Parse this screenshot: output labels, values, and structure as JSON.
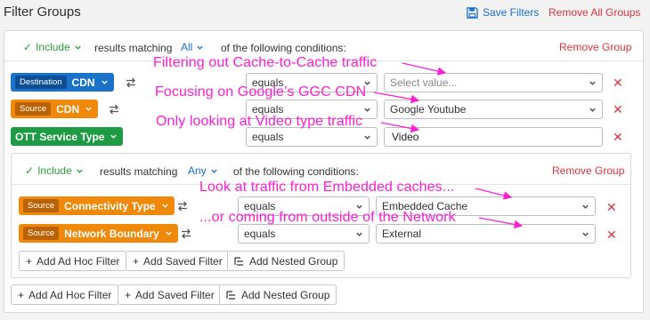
{
  "header": {
    "title": "Filter Groups",
    "save_label": "Save Filters",
    "remove_all_label": "Remove All Groups"
  },
  "outer_group": {
    "include_label": "Include",
    "matching_text": "results matching",
    "mode": "All",
    "conditions_text": "of the following conditions:",
    "remove_label": "Remove Group",
    "rows": [
      {
        "tag": "Destination",
        "dimension": "CDN",
        "operator": "equals",
        "value": "",
        "placeholder": "Select value..."
      },
      {
        "tag": "Source",
        "dimension": "CDN",
        "operator": "equals",
        "value": "Google Youtube"
      },
      {
        "tag": "",
        "dimension": "OTT Service Type",
        "operator": "equals",
        "value": "Video"
      }
    ],
    "buttons": {
      "ad_hoc": "Add Ad Hoc Filter",
      "saved": "Add Saved Filter",
      "nested": "Add Nested Group"
    }
  },
  "nested_group": {
    "include_label": "Include",
    "matching_text": "results matching",
    "mode": "Any",
    "conditions_text": "of the following conditions:",
    "remove_label": "Remove Group",
    "rows": [
      {
        "tag": "Source",
        "dimension": "Connectivity Type",
        "operator": "equals",
        "value": "Embedded Cache"
      },
      {
        "tag": "Source",
        "dimension": "Network Boundary",
        "operator": "equals",
        "value": "External"
      }
    ],
    "buttons": {
      "ad_hoc": "Add Ad Hoc Filter",
      "saved": "Add Saved Filter",
      "nested": "Add Nested Group"
    }
  },
  "annotations": [
    "Filtering out Cache-to-Cache traffic",
    "Focusing on Google’s GGC CDN",
    "Only looking at Video type traffic",
    "Look at traffic from Embedded caches...",
    "...or coming from outside of the Network"
  ],
  "colors": {
    "annotation": "#ff1fd2",
    "link": "#1a6fd1",
    "danger": "#d9363e",
    "include": "#2e9b3f",
    "dest_blue": "#1a73c8",
    "source_orange": "#f0880a",
    "ott_green": "#1f9a45"
  },
  "icons": {
    "save": "floppy-disk-icon",
    "swap": "swap-arrows-icon",
    "remove": "close-x-icon",
    "chevron": "chevron-down-icon",
    "check": "checkmark-icon",
    "plus": "plus-icon",
    "nested": "nested-list-icon"
  }
}
